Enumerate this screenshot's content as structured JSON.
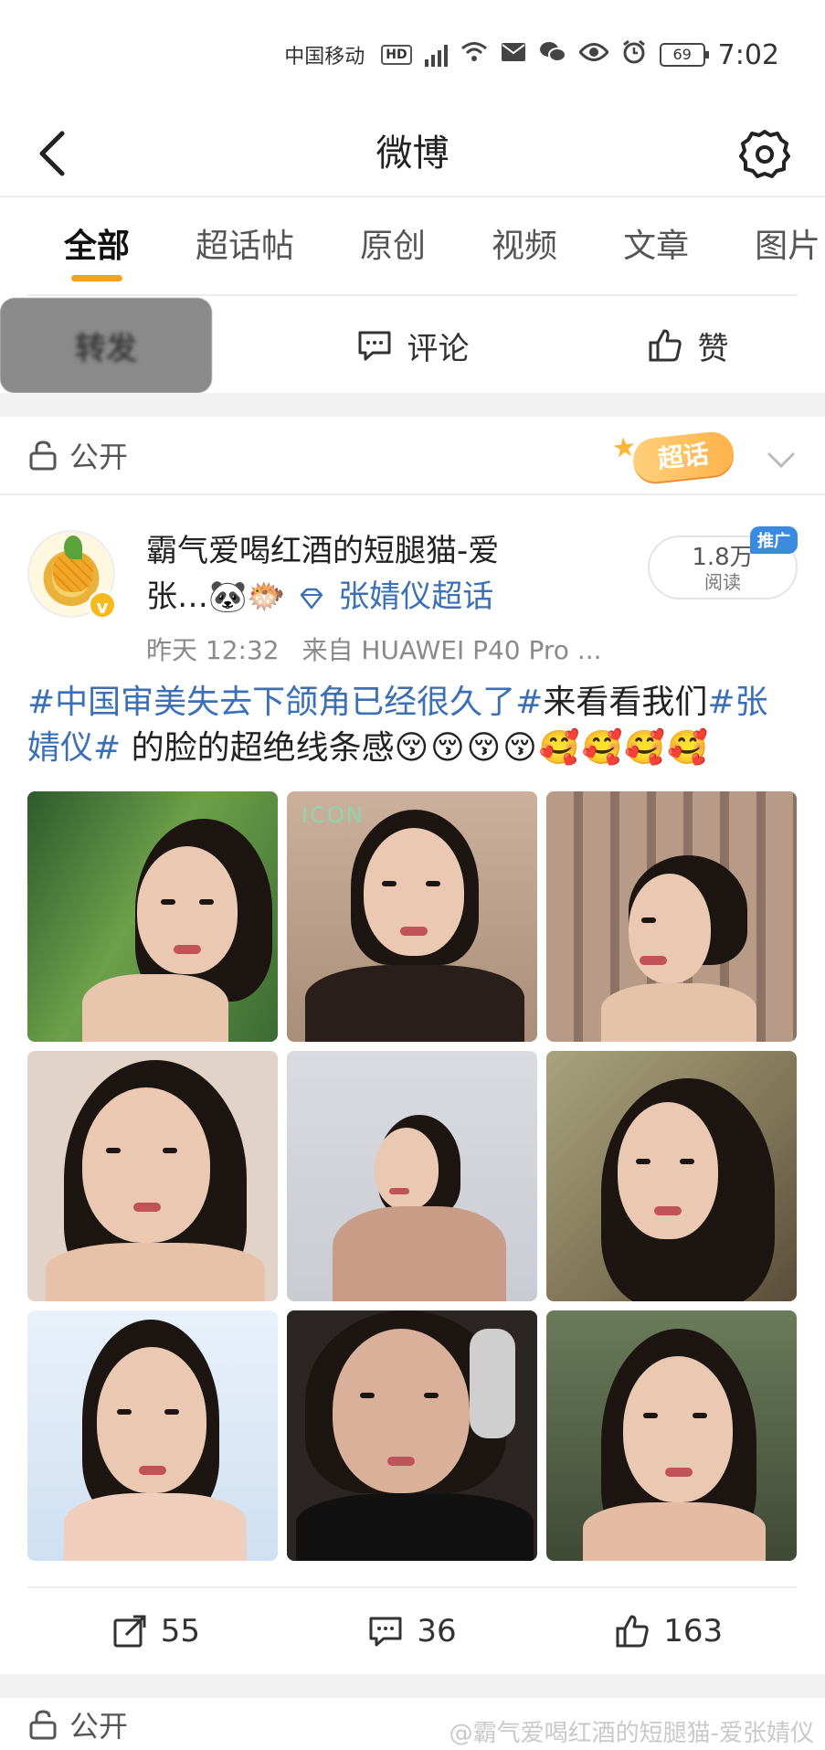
{
  "status_bar": {
    "carrier": "中国移动",
    "hd": "HD",
    "network": "6",
    "battery": "69",
    "time": "7:02"
  },
  "header": {
    "title": "微博"
  },
  "tabs": [
    {
      "label": "全部",
      "active": true
    },
    {
      "label": "超话帖",
      "active": false
    },
    {
      "label": "原创",
      "active": false
    },
    {
      "label": "视频",
      "active": false
    },
    {
      "label": "文章",
      "active": false
    },
    {
      "label": "图片",
      "active": false
    }
  ],
  "prev_post_actions": {
    "repost": "转发",
    "comment": "评论",
    "like": "赞"
  },
  "post": {
    "visibility": "公开",
    "super_topic_badge": "超话",
    "author_line1": "霸气爱喝红酒的短腿猫-爱",
    "author_line2": "张…🐼🐡",
    "super_topic_link": "张婧仪超话",
    "verified_mark": "v",
    "time": "昨天 12:32",
    "source": "来自 HUAWEI P40 Pro ...",
    "reads_count": "1.8万",
    "reads_label": "阅读",
    "promo_badge": "推广",
    "text_tag1": "#中国审美失去下颌角已经很久了#",
    "text_mid": "来看看我们",
    "text_tag2a": "#张",
    "text_tag2b": "婧仪#",
    "text_tail": " 的脸的超绝线条感",
    "emojis": "😚😚😚😚🥰🥰🥰🥰",
    "image_caption": "ICON",
    "repost_count": "55",
    "comment_count": "36",
    "like_count": "163"
  },
  "next_post": {
    "visibility": "公开"
  },
  "watermark": "@霸气爱喝红酒的短腿猫-爱张婧仪",
  "colors": {
    "accent": "#f6a21e",
    "link": "#3b6fb6",
    "separator": "#f2f2f2"
  }
}
